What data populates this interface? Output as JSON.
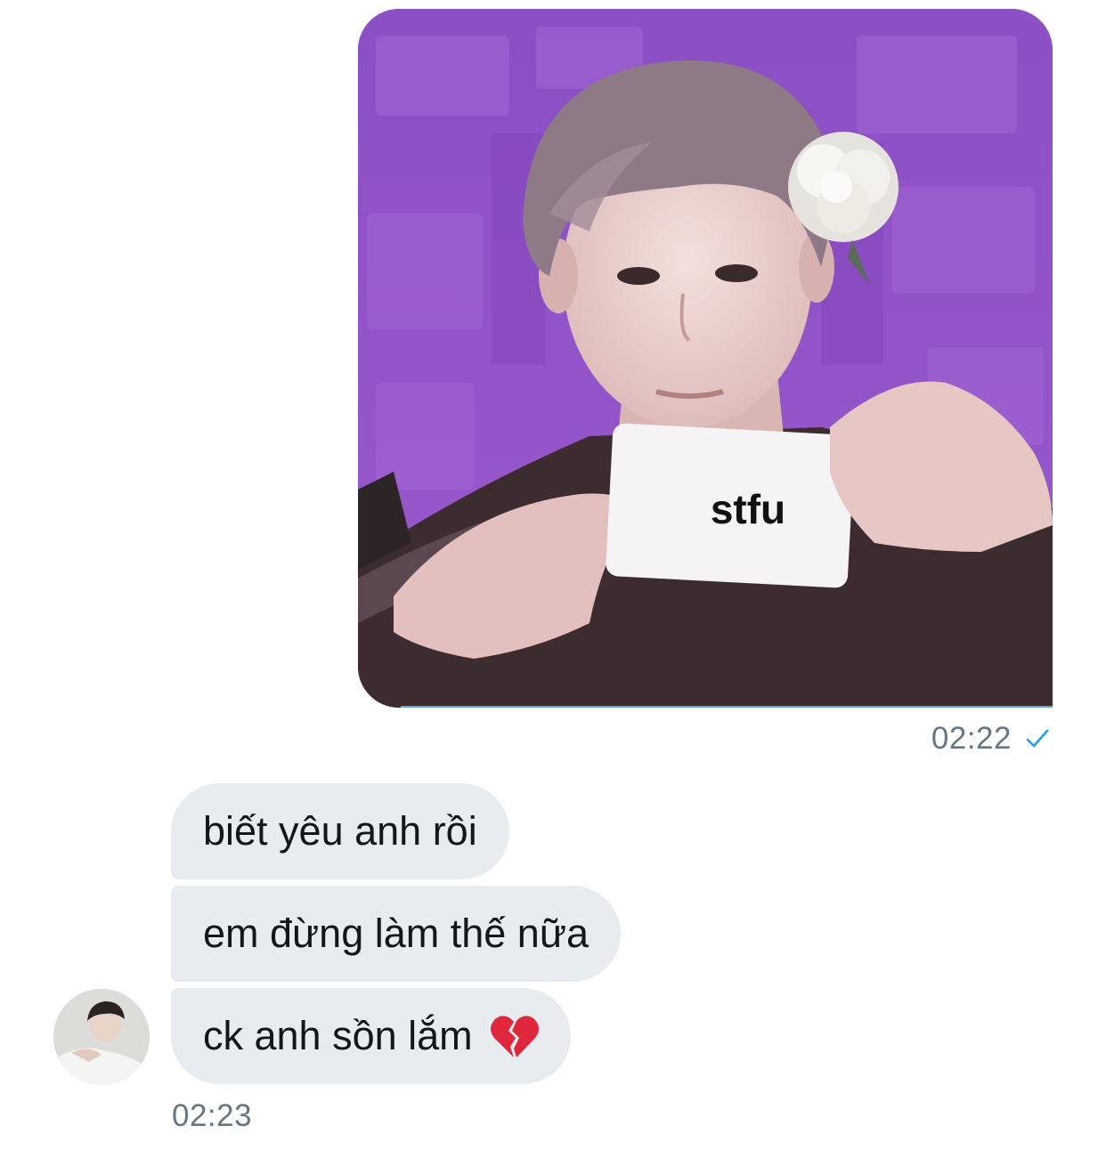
{
  "conversation": {
    "outgoing": {
      "media": {
        "kind": "image",
        "card_text": "stfu"
      },
      "time": "02:22",
      "status_icon": "read-check-icon"
    },
    "incoming": {
      "messages": [
        {
          "text": "biết yêu anh rồi"
        },
        {
          "text": "em đừng làm thế nữa"
        },
        {
          "text": "ck anh sồn lắm",
          "emoji": "broken-heart-icon"
        }
      ],
      "time": "02:23",
      "avatar": "contact-avatar"
    }
  },
  "colors": {
    "incoming_bubble": "#e6ecf0",
    "timestamp": "#657786",
    "read_check": "#1da1f2",
    "photo_background": "#8f52c3"
  }
}
